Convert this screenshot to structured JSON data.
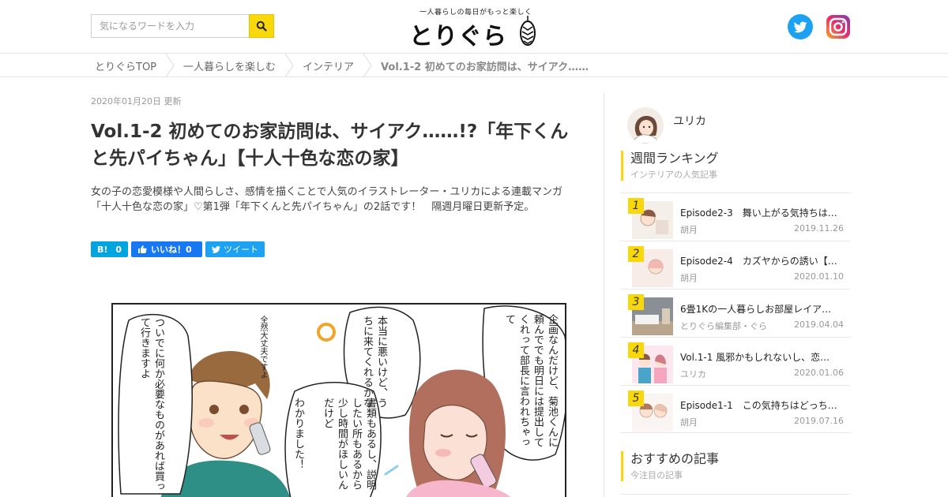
{
  "header": {
    "search_placeholder": "気になるワードを入力",
    "logo_tagline": "一人暮らしの毎日がもっと楽しく",
    "logo_text": "とりぐら"
  },
  "breadcrumb": [
    {
      "label": "とりぐらTOP"
    },
    {
      "label": "一人暮らしを楽しむ"
    },
    {
      "label": "インテリア"
    },
    {
      "label": "Vol.1-2 初めてのお家訪問は、サイアク……"
    }
  ],
  "article": {
    "date": "2020年01月20日 更新",
    "title": "Vol.1-2 初めてのお家訪問は、サイアク……!?「年下くんと先パイちゃん」【十人十色な恋の家】",
    "lead": "女の子の恋愛模様や人間らしさ、感情を描くことで人気のイラストレーター・ユリカによる連載マンガ「十人十色な恋の家」♡第1弾「年下くんと先パイちゃん」の2話です！　隔週月曜日更新予定。",
    "share": {
      "hatena_icon": "B!",
      "hatena_count": "0",
      "facebook_label": "いいね！0",
      "twitter_label": "ツイート"
    },
    "comic": {
      "bubble_1": "ついでに何か必要なものがあれば買って行きますよ",
      "bubble_2": "全然大丈夫ですよ",
      "bubble_3": "本当に悪いけど、うちに来てくれるかな",
      "bubble_4": "書類もあるし、説明したい所もあるから少し時間がほしいんだけど",
      "bubble_5": "わかりました！",
      "bubble_6": "企画なんだけど、菊池くんに頼んででも明日には提出してくれって部長に言われちゃって"
    }
  },
  "sidebar": {
    "author_name": "ユリカ",
    "ranking_heading": "週間ランキング",
    "ranking_sub": "インテリアの人気記事",
    "ranking": [
      {
        "rank": "1",
        "title": "Episode2-3　舞い上がる気持ちは…",
        "author": "胡月",
        "date": "2019.11.26"
      },
      {
        "rank": "2",
        "title": "Episode2-4　カズヤからの誘い【…",
        "author": "胡月",
        "date": "2020.01.10"
      },
      {
        "rank": "3",
        "title": "6畳1Kの一人暮らしお部屋レイア…",
        "author": "とりぐら編集部・ぐら",
        "date": "2019.04.04"
      },
      {
        "rank": "4",
        "title": "Vol.1-1 風邪かもしれないし、恋…",
        "author": "ユリカ",
        "date": "2020.01.06"
      },
      {
        "rank": "5",
        "title": "Episode1-1　この気持ちはどっち…",
        "author": "胡月",
        "date": "2019.07.16"
      }
    ],
    "recommend_heading": "おすすめの記事",
    "recommend_sub": "今注目の記事"
  },
  "colors": {
    "accent": "#f8d80a",
    "twitter": "#1da1f2",
    "facebook": "#1877f2",
    "hatena": "#00a4de"
  }
}
